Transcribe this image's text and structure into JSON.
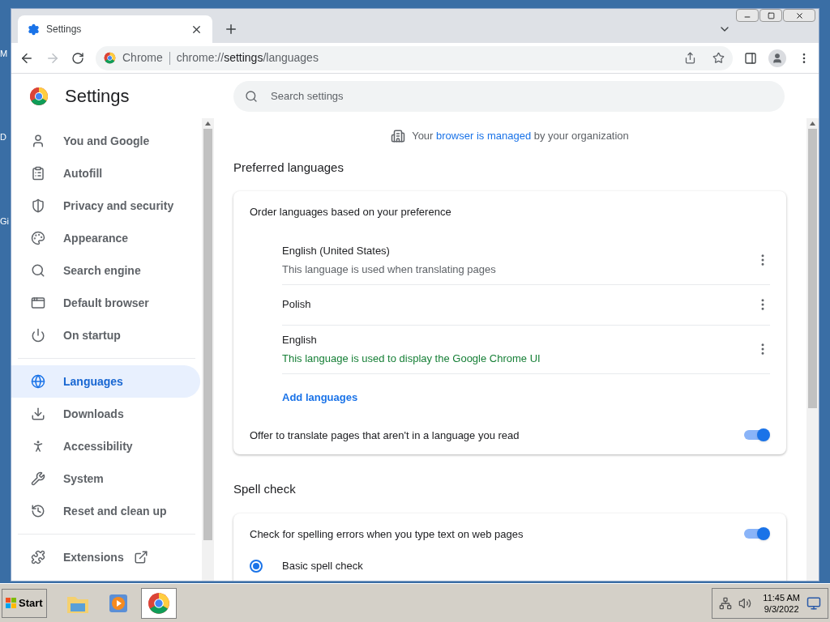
{
  "desktop_labels": [
    "M",
    "D",
    "Gi"
  ],
  "tab": {
    "title": "Settings"
  },
  "address": {
    "site": "Chrome",
    "url_prefix": "chrome://",
    "url_host": "settings",
    "url_path": "/languages"
  },
  "header": {
    "title": "Settings",
    "search_placeholder": "Search settings"
  },
  "sidebar": {
    "items": [
      {
        "label": "You and Google",
        "selected": false
      },
      {
        "label": "Autofill",
        "selected": false
      },
      {
        "label": "Privacy and security",
        "selected": false
      },
      {
        "label": "Appearance",
        "selected": false
      },
      {
        "label": "Search engine",
        "selected": false
      },
      {
        "label": "Default browser",
        "selected": false
      },
      {
        "label": "On startup",
        "selected": false
      },
      {
        "label": "Languages",
        "selected": true
      },
      {
        "label": "Downloads",
        "selected": false
      },
      {
        "label": "Accessibility",
        "selected": false
      },
      {
        "label": "System",
        "selected": false
      },
      {
        "label": "Reset and clean up",
        "selected": false
      }
    ],
    "extensions": "Extensions"
  },
  "managed_notice": {
    "before": "Your",
    "link": "browser is managed",
    "after": "by your organization"
  },
  "preferred_languages": {
    "title": "Preferred languages",
    "intro": "Order languages based on your preference",
    "languages": [
      {
        "name": "English (United States)",
        "note": "This language is used when translating pages",
        "kind": "plain"
      },
      {
        "name": "Polish"
      },
      {
        "name": "English",
        "note": "This language is used to display the Google Chrome UI",
        "kind": "highlight"
      }
    ],
    "add_link": "Add languages",
    "offer_translate": {
      "label": "Offer to translate pages that aren't in a language you read",
      "on": true
    }
  },
  "spell_check": {
    "title": "Spell check",
    "check": {
      "label": "Check for spelling errors when you type text on web pages",
      "on": true
    },
    "options": [
      {
        "label": "Basic spell check",
        "selected": true
      }
    ]
  },
  "taskbar": {
    "start": "Start",
    "apps": [
      {
        "kind": "folder",
        "selected": false
      },
      {
        "kind": "media",
        "selected": false
      },
      {
        "kind": "chrome",
        "selected": true
      }
    ],
    "time": "11:45 AM",
    "date": "9/3/2022"
  }
}
